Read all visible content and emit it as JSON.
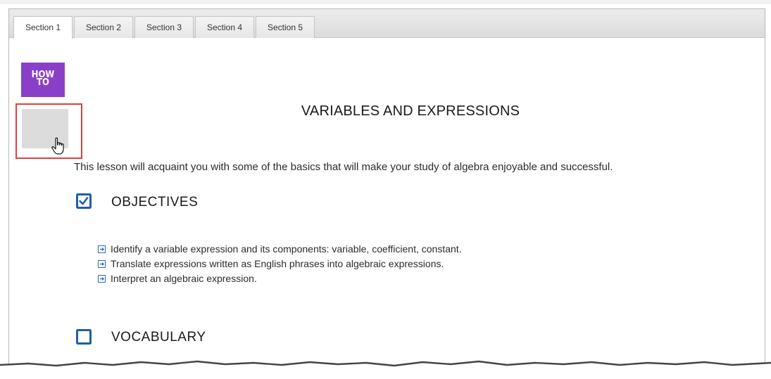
{
  "tabs": [
    {
      "label": "Section 1",
      "active": true
    },
    {
      "label": "Section 2",
      "active": false
    },
    {
      "label": "Section 3",
      "active": false
    },
    {
      "label": "Section 4",
      "active": false
    },
    {
      "label": "Section 5",
      "active": false
    }
  ],
  "sidebar": {
    "howto_line1": "HOW",
    "howto_line2": "TO",
    "howto_color": "#8a3fc9",
    "highlight_color": "#e0403a"
  },
  "lesson": {
    "title": "VARIABLES AND EXPRESSIONS",
    "intro": "This lesson will acquaint you with some of the basics that will make your study of algebra enjoyable and successful."
  },
  "objectives": {
    "heading": "OBJECTIVES",
    "checked": true,
    "items": [
      "Identify a variable expression and its components: variable, coefficient, constant.",
      "Translate expressions written as English phrases into algebraic expressions.",
      "Interpret an algebraic expression."
    ]
  },
  "vocabulary": {
    "heading": "VOCABULARY",
    "checked": false
  },
  "accent_color": "#1f5fa6"
}
